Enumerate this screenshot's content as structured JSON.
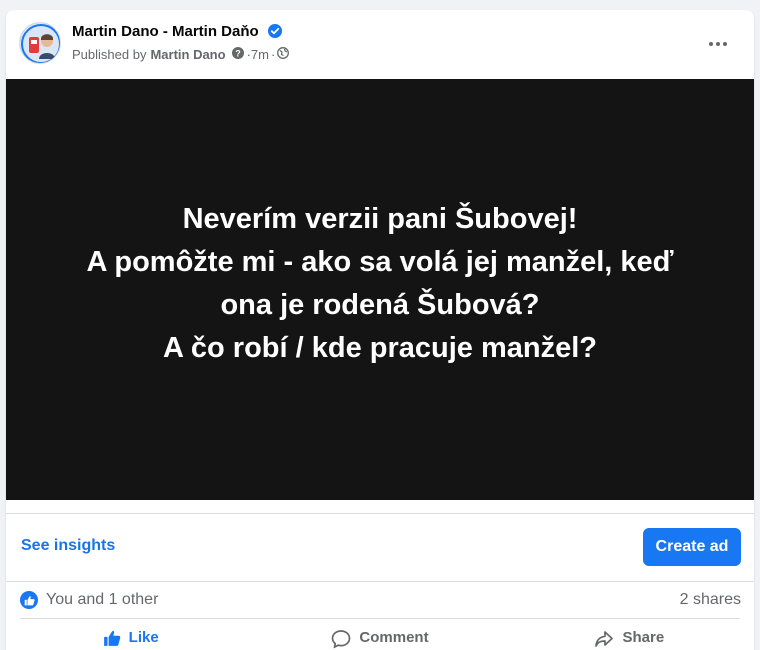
{
  "post": {
    "author": "Martin Dano - Martin Daňo",
    "published_by_prefix": "Published by",
    "published_by_name": "Martin Dano",
    "time": "7m",
    "separator": "·",
    "image_text": [
      "Neverím verzii pani Šubovej!",
      "A pomôžte mi - ako sa volá jej manžel, keď",
      "ona je rodená Šubová?",
      "A čo robí / kde pracuje manžel?"
    ]
  },
  "insights": {
    "see_insights_label": "See insights",
    "create_ad_label": "Create ad"
  },
  "reactions": {
    "summary": "You and 1 other",
    "shares": "2 shares"
  },
  "actions": {
    "like": "Like",
    "comment": "Comment",
    "share": "Share"
  },
  "colors": {
    "accent": "#1877f2",
    "link": "#1b74e4",
    "image_background": "#141414",
    "muted_text": "#65676b"
  },
  "icons": [
    "verified-badge-icon",
    "question-icon",
    "globe-icon",
    "more-options-icon",
    "like-reaction-icon",
    "like-icon",
    "comment-icon",
    "share-icon"
  ]
}
